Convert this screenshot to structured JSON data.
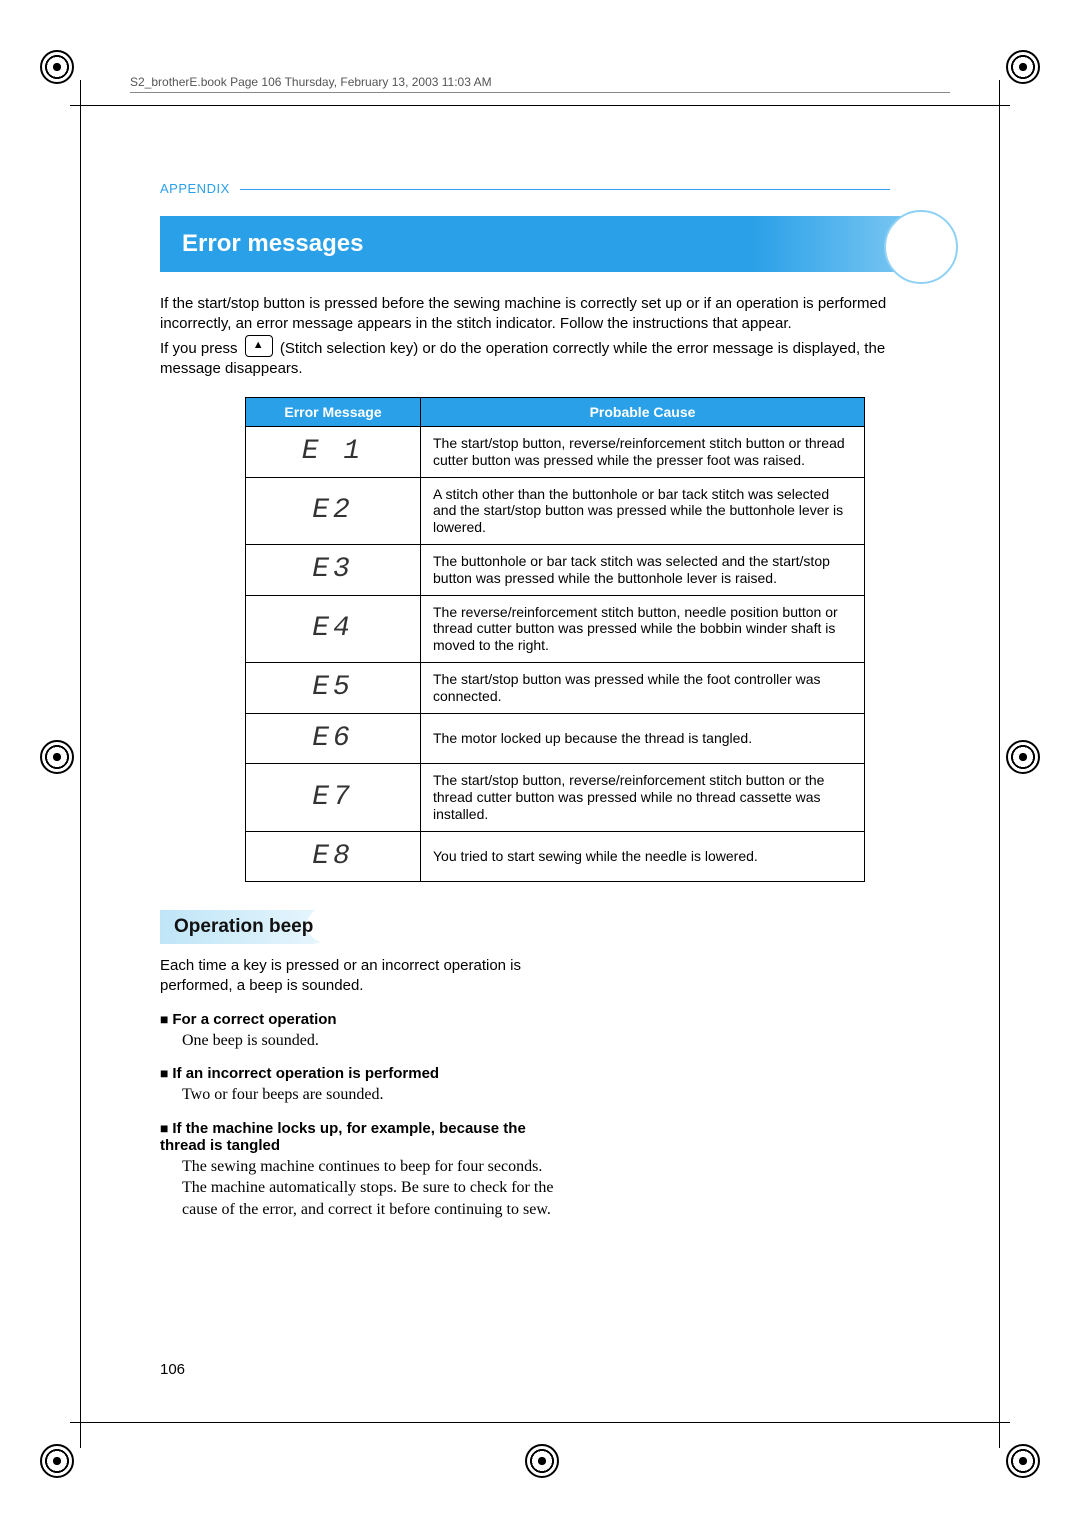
{
  "meta": {
    "header_line": "S2_brotherE.book  Page 106  Thursday, February 13, 2003  11:03 AM",
    "appendix_label": "APPENDIX",
    "page_number": "106"
  },
  "section": {
    "title": "Error messages",
    "intro1": "If the start/stop button is pressed before the sewing machine is correctly set up or if an operation is performed incorrectly, an error message appears in the stitch indicator. Follow the instructions that appear.",
    "intro2_a": "If you press ",
    "intro2_b": " (Stitch selection key) or do the operation correctly while the error message is displayed, the message disappears."
  },
  "table": {
    "head_code": "Error Message",
    "head_cause": "Probable Cause",
    "rows": [
      {
        "code": "E1",
        "seg": "E 1",
        "cause": "The start/stop button, reverse/reinforcement stitch button or thread cutter button was pressed while the presser foot was raised."
      },
      {
        "code": "E2",
        "seg": "E2",
        "cause": "A stitch other than the buttonhole or bar tack stitch was selected and the start/stop button was pressed while the buttonhole lever is lowered."
      },
      {
        "code": "E3",
        "seg": "E3",
        "cause": "The buttonhole or bar tack stitch was selected and the start/stop button was pressed while the buttonhole lever is raised."
      },
      {
        "code": "E4",
        "seg": "E4",
        "cause": "The reverse/reinforcement stitch button, needle position button or thread cutter button was pressed while the bobbin winder shaft is moved to the right."
      },
      {
        "code": "E5",
        "seg": "E5",
        "cause": "The start/stop button was pressed while the foot controller was connected."
      },
      {
        "code": "E6",
        "seg": "E6",
        "cause": "The motor locked up because the thread is tangled."
      },
      {
        "code": "E7",
        "seg": "E7",
        "cause": "The start/stop button, reverse/reinforcement stitch button or the thread cutter button was pressed while no thread cassette was installed."
      },
      {
        "code": "E8",
        "seg": "E8",
        "cause": "You tried to start sewing while the needle is lowered."
      }
    ]
  },
  "subsection": {
    "title": "Operation beep",
    "intro": "Each time a key is pressed or an incorrect operation is performed, a beep is sounded.",
    "items": [
      {
        "head": "For a correct operation",
        "body": "One beep is sounded."
      },
      {
        "head": "If an incorrect operation is performed",
        "body": "Two or four beeps are sounded."
      },
      {
        "head": "If the machine locks up, for example, because the thread is tangled",
        "body": "The sewing machine continues to beep for four seconds. The machine automatically stops. Be sure to check for the cause of the error, and correct it before continuing to sew."
      }
    ]
  }
}
